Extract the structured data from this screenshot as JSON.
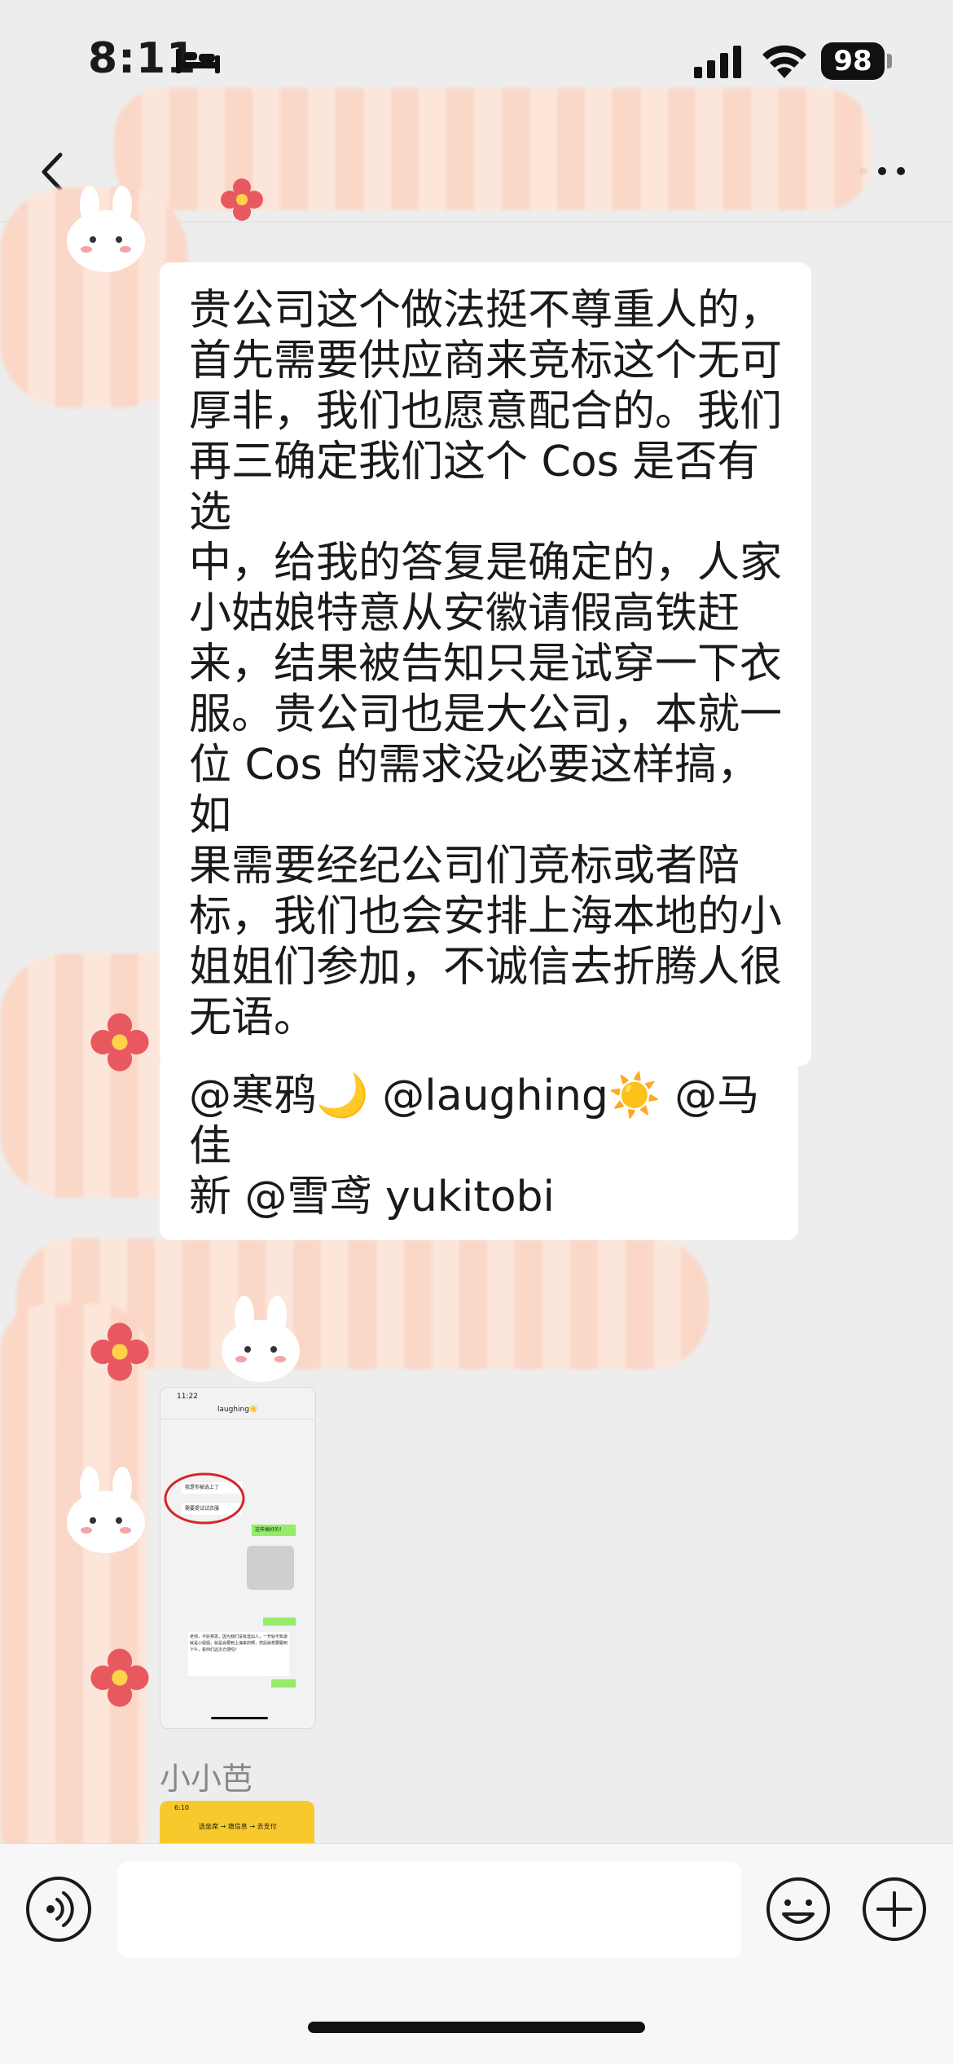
{
  "status_bar": {
    "time": "8:11",
    "battery": "98"
  },
  "chat": {
    "messages": [
      {
        "text": "贵公司这个做法挺不尊重人的，\n首先需要供应商来竞标这个无可\n厚非，我们也愿意配合的。我们\n再三确定我们这个 Cos 是否有选\n中，给我的答复是确定的，人家\n小姑娘特意从安徽请假高铁赶\n来，结果被告知只是试穿一下衣\n服。贵公司也是大公司，本就一\n位 Cos 的需求没必要这样搞，如\n果需要经纪公司们竞标或者陪\n标，我们也会安排上海本地的小\n姐姐们参加，不诚信去折腾人很\n无语。"
      },
      {
        "text": "@寒鸦🌙 @laughing☀️ @马佳\n新 @雪鸢 yukitobi"
      }
    ],
    "image_message": {
      "time": "11:22",
      "title": "laughing☀️",
      "bubbles": [
        "我是你被选上了",
        "需要提试试衣服",
        "这样搞好的！",
        "老师，不好意思，因为我们没有选出人，一开始不知道就是小姐姐，就是会要到上海来的啊，然后就想要跟到下午，看你们这次方便吗？"
      ]
    },
    "sender_name": "小小芭",
    "card": {
      "time": "6:10",
      "text": "选坐席 → 填信息 → 去支付"
    }
  },
  "input_bar": {
    "placeholder": ""
  }
}
